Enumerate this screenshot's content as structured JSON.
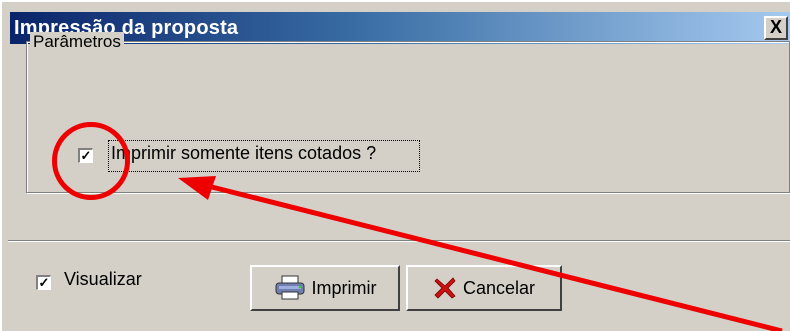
{
  "window": {
    "title": "Impressão da proposta",
    "close_glyph": "X"
  },
  "parameters": {
    "legend": "Parâmetros",
    "checkbox_label": "Imprimir somente itens cotados ?",
    "checked": true
  },
  "footer": {
    "visualizar_label": "Visualizar",
    "visualizar_checked": true,
    "print_label": "Imprimir",
    "cancel_label": "Cancelar"
  },
  "icons": {
    "print": "printer-icon",
    "cancel": "red-x-icon",
    "check": "✓"
  },
  "annotation": {
    "color": "#ee0000",
    "shapes": [
      "circle",
      "arrow"
    ]
  }
}
